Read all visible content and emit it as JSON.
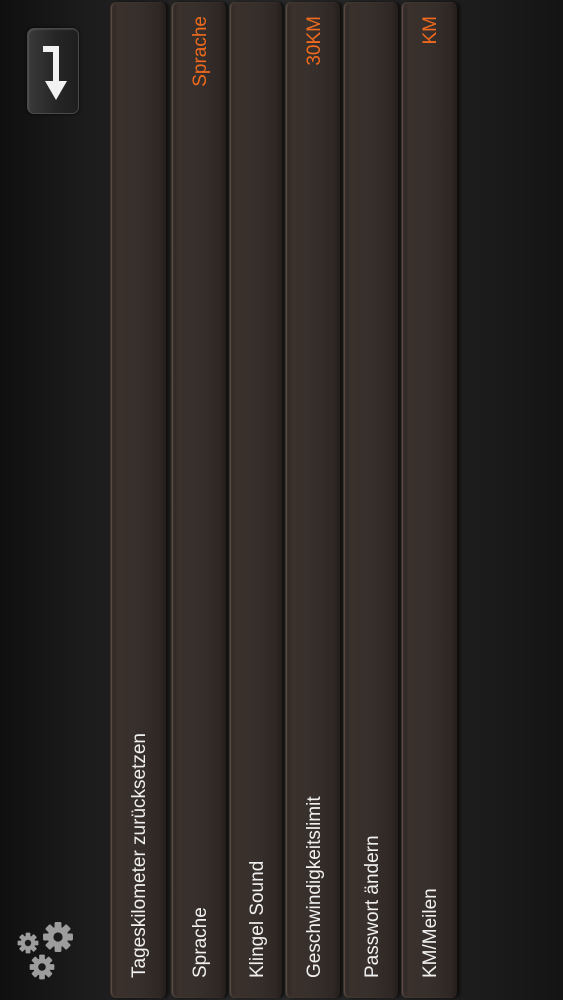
{
  "toolbar": {
    "back_icon": "arrow-down-return-icon",
    "settings_icon": "gears-icon"
  },
  "settings": {
    "rows": [
      {
        "label": "Tageskilometer zurücksetzen",
        "value": ""
      },
      {
        "label": "Sprache",
        "value": "Sprache"
      },
      {
        "label": "Klingel Sound",
        "value": ""
      },
      {
        "label": "Geschwindigkeitslimit",
        "value": "30KM"
      },
      {
        "label": "Passwort ändern",
        "value": ""
      },
      {
        "label": "KM/Meilen",
        "value": "KM"
      }
    ]
  },
  "colors": {
    "accent": "#ef6a1e",
    "row_text": "#f0f0f0",
    "background": "#121212"
  }
}
